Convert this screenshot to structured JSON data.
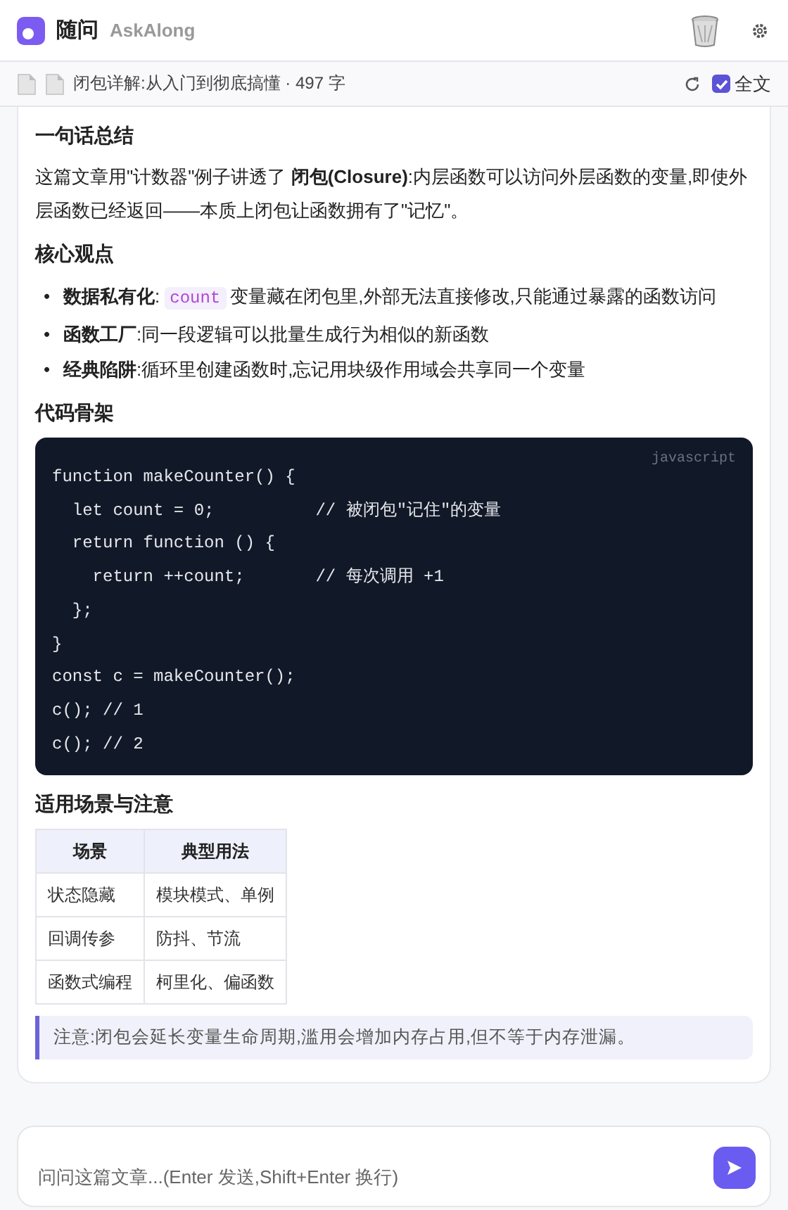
{
  "header": {
    "title": "随问",
    "subtitle": "AskAlong"
  },
  "doc_bar": {
    "title": "闭包详解:从入门到彻底搞懂 · 497 字",
    "full_text": {
      "label": "全文",
      "checked": true
    }
  },
  "summary": {
    "heading": "一句话总结",
    "text": "这篇文章用\"计数器\"例子讲透了 **闭包(Closure)**:内层函数可以访问外层函数的变量,即使外层函数已经返回——本质上闭包让函数拥有了\"记忆\"。"
  },
  "points": {
    "heading": "核心观点",
    "items": [
      {
        "marker": "•",
        "lead": "**数据私有化**:",
        "code": "count",
        "text": "变量藏在闭包里,外部无法直接修改,只能通过暴露的函数访问"
      },
      {
        "marker": "•",
        "lead": "**函数工厂**:",
        "text": "同一段逻辑可以批量生成行为相似的新函数"
      },
      {
        "marker": "•",
        "lead": "**经典陷阱**:",
        "text": "循环里创建函数时,忘记用块级作用域会共享同一个变量"
      }
    ]
  },
  "code": {
    "heading": "代码骨架",
    "language": "javascript",
    "lines": [
      "function makeCounter() {",
      "  let count = 0;          // 被闭包\"记住\"的变量",
      "  return function () {",
      "    return ++count;       // 每次调用 +1",
      "  };",
      "}",
      "const c = makeCounter();",
      "c(); // 1",
      "c(); // 2"
    ]
  },
  "usage": {
    "heading": "适用场景与注意",
    "columns": [
      "场景",
      "典型用法"
    ],
    "rows": [
      [
        "状态隐藏",
        "模块模式、单例"
      ],
      [
        "回调传参",
        "防抖、节流"
      ],
      [
        "函数式编程",
        "柯里化、偏函数"
      ]
    ],
    "note": "注意:闭包会延长变量生命周期,滥用会增加内存占用,但不等于内存泄漏。"
  },
  "chat": {
    "placeholder": "问问这篇文章...(Enter 发送,Shift+Enter 换行)"
  }
}
